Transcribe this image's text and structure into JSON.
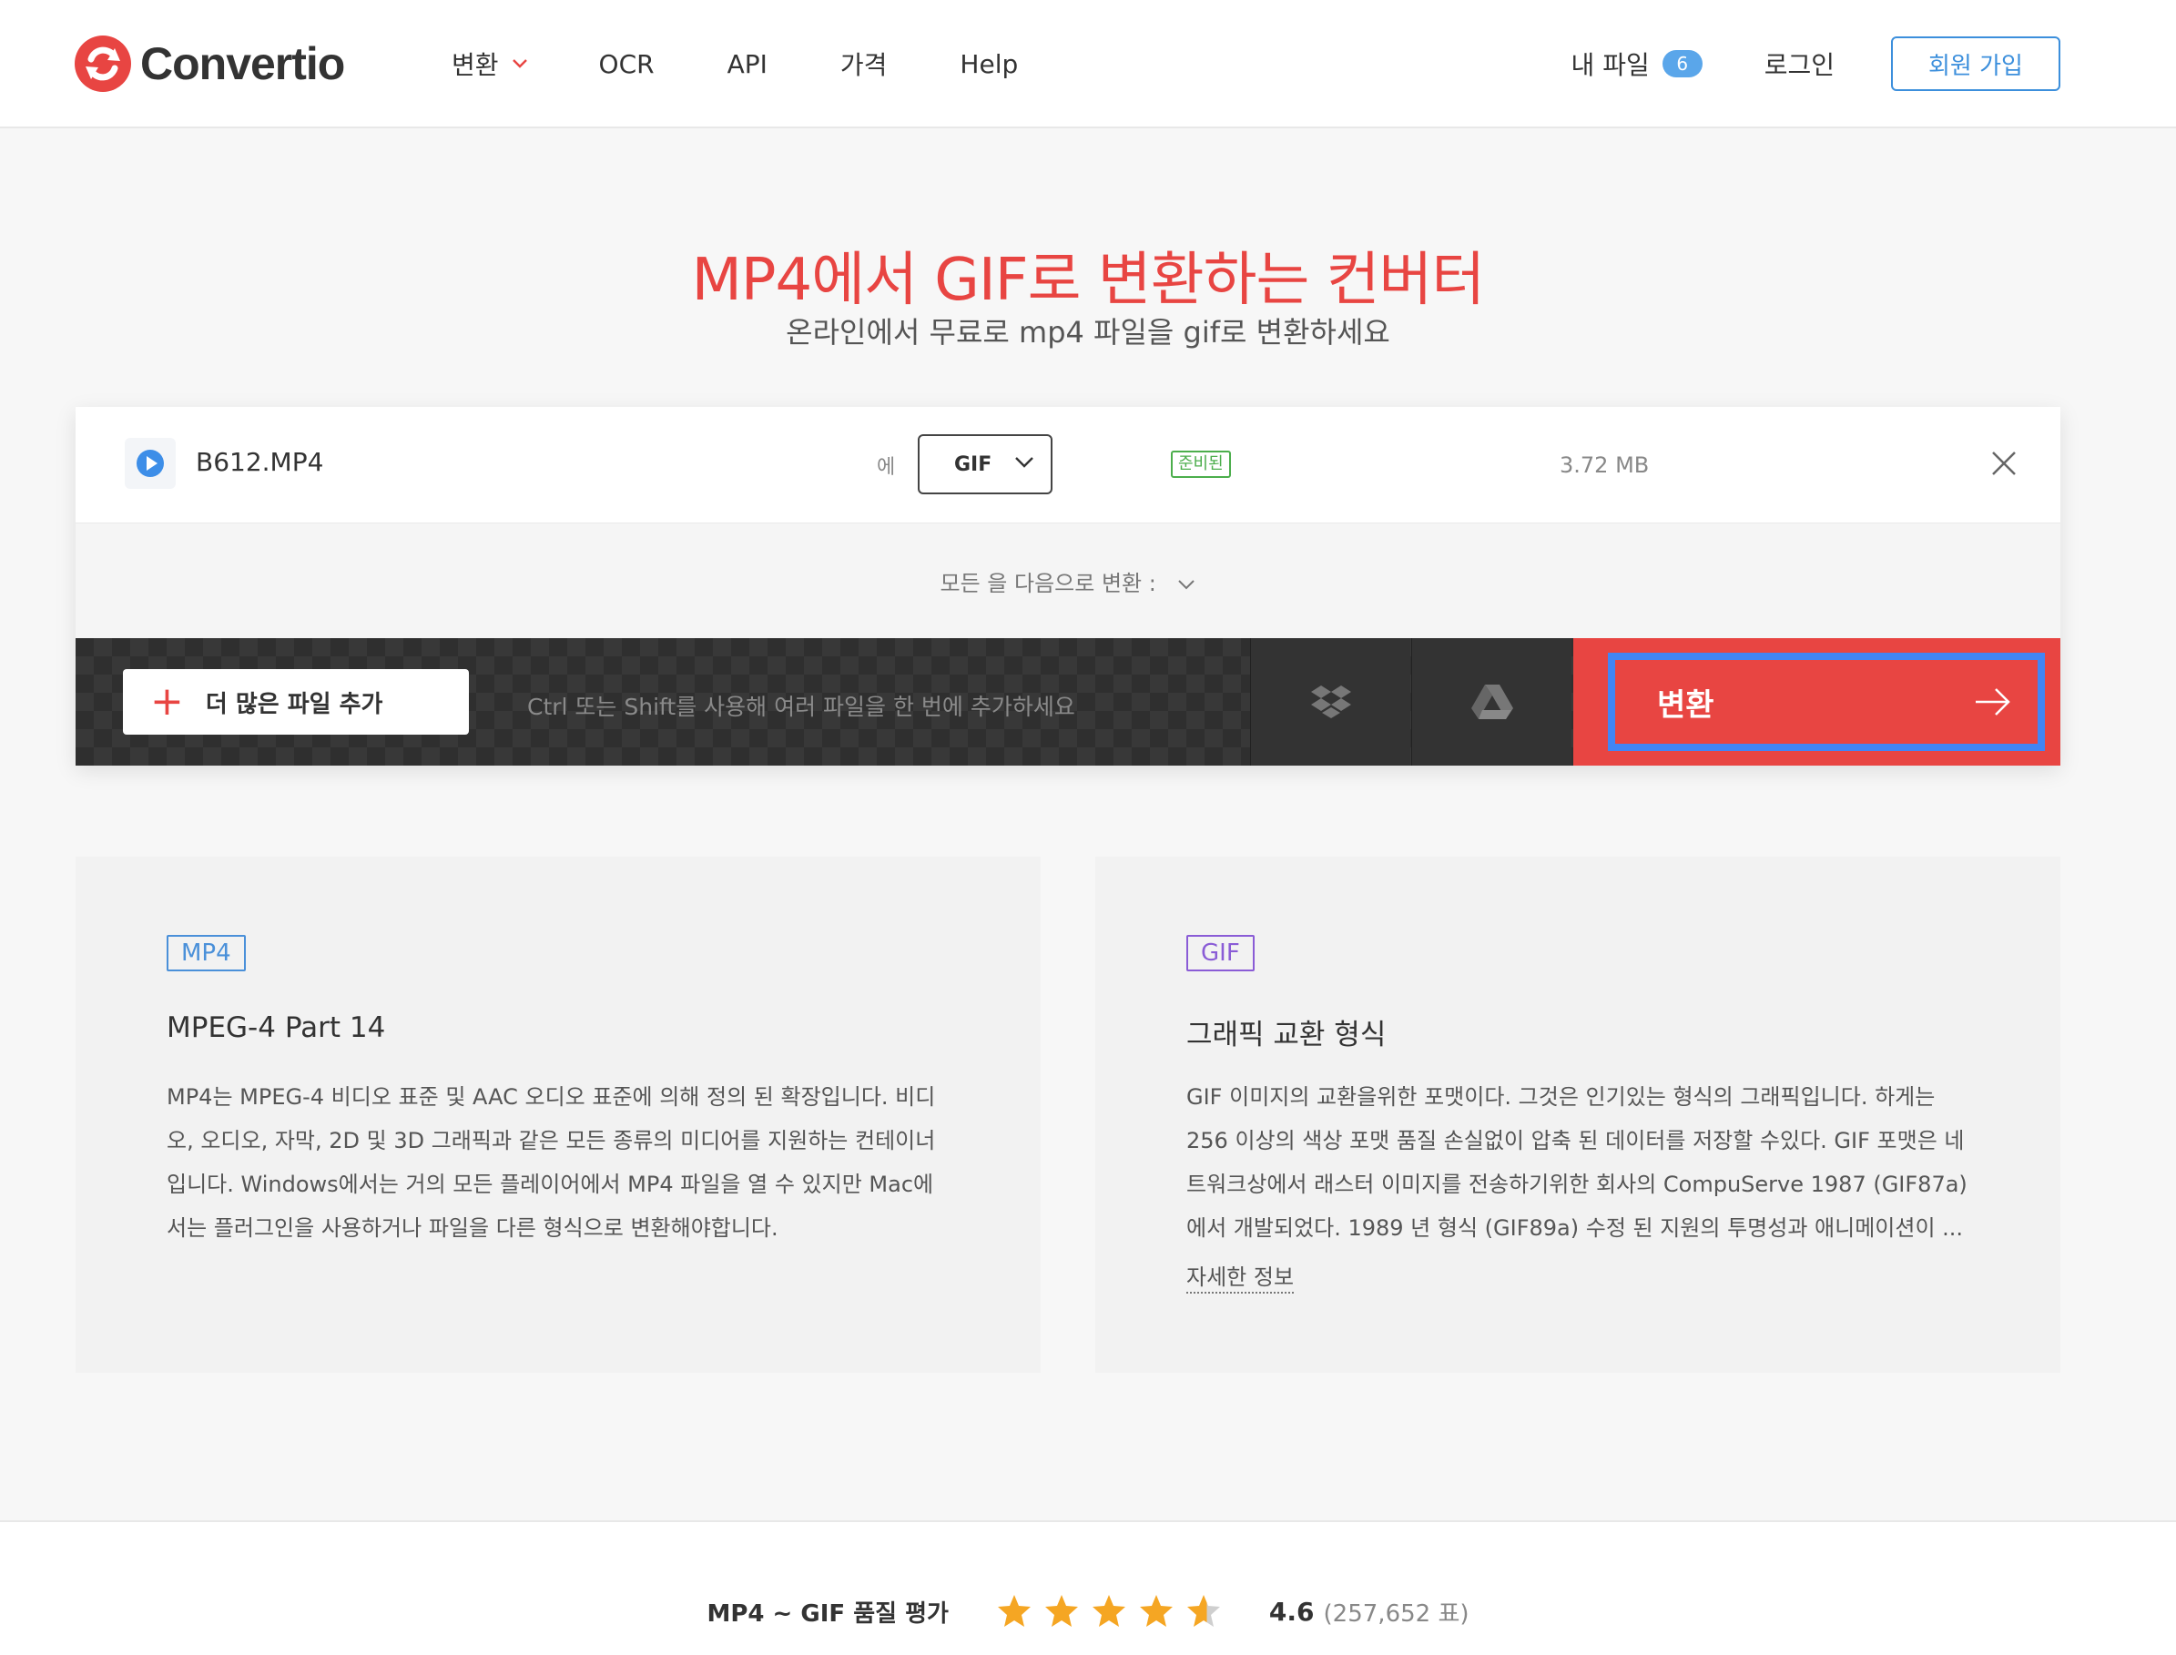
{
  "header": {
    "logo_text": "Convertio",
    "nav": [
      {
        "label": "변환"
      },
      {
        "label": "OCR"
      },
      {
        "label": "API"
      },
      {
        "label": "가격"
      },
      {
        "label": "Help"
      }
    ],
    "my_files_label": "내 파일",
    "my_files_count": "6",
    "login_label": "로그인",
    "signup_label": "회원 가입"
  },
  "hero": {
    "title": "MP4에서 GIF로 변환하는 컨버터",
    "subtitle": "온라인에서 무료로 mp4 파일을 gif로 변환하세요"
  },
  "converter": {
    "file_name": "B612.MP4",
    "to_label": "에",
    "format": "GIF",
    "status": "준비된",
    "file_size": "3.72 MB",
    "convert_all_label": "모든 을 다음으로 변환 :",
    "add_files_label": "더 많은 파일 추가",
    "hint": "Ctrl 또는 Shift를 사용해 여러 파일을 한 번에 추가하세요",
    "convert_label": "변환"
  },
  "cards": [
    {
      "tag": "MP4",
      "tag_color": "#4a90d9",
      "title": "MPEG-4 Part 14",
      "lines": [
        "MP4는 MPEG-4 비디오 표준 및 AAC 오디오 표준에 의해 정의 된 확장입니다. 비디",
        "오, 오디오, 자막, 2D 및 3D 그래픽과 같은 모든 종류의 미디어를 지원하는 컨테이너",
        "입니다. Windows에서는 거의 모든 플레이어에서 MP4 파일을 열 수 있지만 Mac에",
        "서는 플러그인을 사용하거나 파일을 다른 형식으로 변환해야합니다."
      ]
    },
    {
      "tag": "GIF",
      "tag_color": "#8a5cd6",
      "title": "그래픽 교환 형식",
      "lines": [
        "GIF 이미지의 교환을위한 포맷이다. 그것은 인기있는 형식의 그래픽입니다. 하게는",
        "256 이상의 색상 포맷 품질 손실없이 압축 된 데이터를 저장할 수있다. GIF 포맷은 네",
        "트워크상에서 래스터 이미지를 전송하기위한 회사의 CompuServe 1987 (GIF87a)",
        "에서 개발되었다. 1989 년 형식 (GIF89a) 수정 된 지원의 투명성과 애니메이션이 ..."
      ],
      "more_label": "자세한 정보"
    }
  ],
  "rating": {
    "label": "MP4 ~ GIF 품질 평가",
    "stars_value": 4.6,
    "score": "4.6",
    "votes": "(257,652 표)"
  },
  "colors": {
    "brand": "#e84542",
    "accent_blue": "#3c8fdc",
    "focus_outline": "#4285f4",
    "ready_green": "#4cae4c",
    "star": "#f5a623"
  }
}
